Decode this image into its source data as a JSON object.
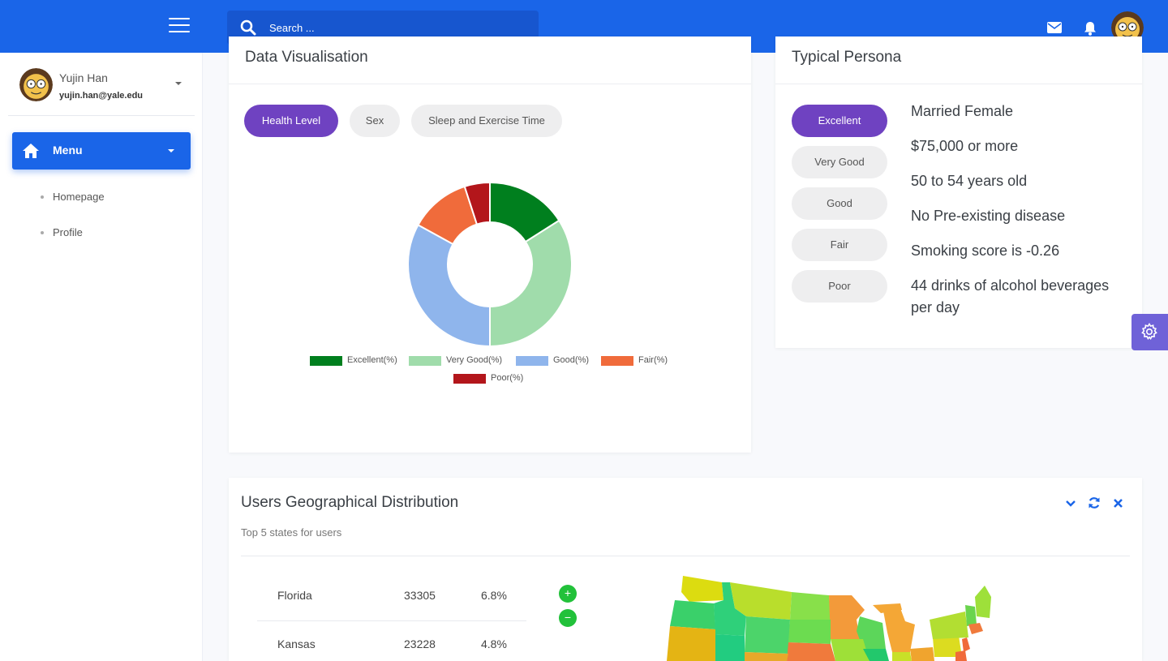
{
  "search": {
    "placeholder": "Search ..."
  },
  "user": {
    "name": "Yujin Han",
    "email": "yujin.han@yale.edu"
  },
  "sidebar": {
    "menu_label": "Menu",
    "items": [
      {
        "label": "Homepage"
      },
      {
        "label": "Profile"
      }
    ]
  },
  "viz": {
    "title": "Data Visualisation",
    "tabs": [
      {
        "label": "Health Level"
      },
      {
        "label": "Sex"
      },
      {
        "label": "Sleep and Exercise Time"
      }
    ],
    "active_tab": 0
  },
  "chart_data": {
    "type": "pie",
    "donut": true,
    "categories": [
      "Excellent(%)",
      "Very Good(%)",
      "Good(%)",
      "Fair(%)",
      "Poor(%)"
    ],
    "values": [
      16,
      34,
      33,
      12,
      5
    ],
    "colors": [
      "#007f1e",
      "#a0dcab",
      "#8fb5ec",
      "#f06b3b",
      "#b3161b"
    ],
    "legend": "bottom"
  },
  "persona": {
    "title": "Typical Persona",
    "levels": [
      {
        "label": "Excellent"
      },
      {
        "label": "Very Good"
      },
      {
        "label": "Good"
      },
      {
        "label": "Fair"
      },
      {
        "label": "Poor"
      }
    ],
    "active_level": 0,
    "lines": [
      "Married Female",
      "$75,000 or more",
      "50 to 54 years old",
      "No Pre-existing disease",
      "Smoking score is -0.26",
      "44 drinks of alcohol beverages per day"
    ]
  },
  "geo": {
    "title": "Users Geographical Distribution",
    "subtitle": "Top 5 states for users",
    "zoom_in": "+",
    "zoom_out": "−",
    "states": [
      {
        "name": "Florida",
        "count": "33305",
        "pct": "6.8%"
      },
      {
        "name": "Kansas",
        "count": "23228",
        "pct": "4.8%"
      }
    ]
  },
  "colors": {
    "primary": "#1a65e8",
    "accent": "#6f42c1",
    "zoom": "#22c13a"
  },
  "icons": [
    "menu-icon",
    "search-icon",
    "mail-icon",
    "bell-icon",
    "avatar",
    "home-icon",
    "gear-icon",
    "chevron-down-icon",
    "refresh-icon",
    "close-icon"
  ]
}
